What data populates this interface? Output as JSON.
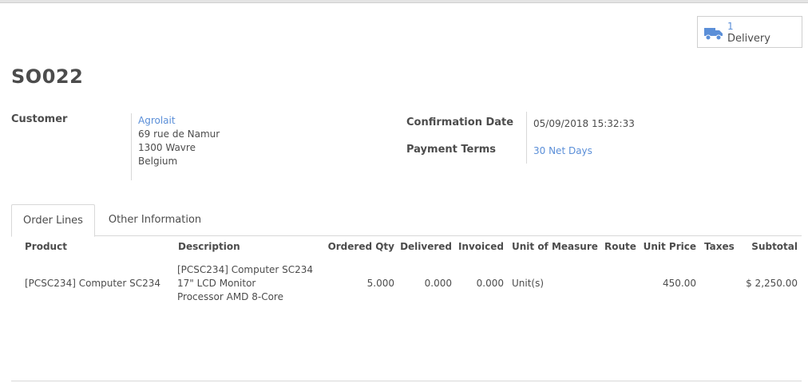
{
  "smart_button": {
    "count": "1",
    "label": "Delivery",
    "icon": "truck-icon"
  },
  "order": {
    "name": "SO022"
  },
  "customer": {
    "label": "Customer",
    "name": "Agrolait",
    "address_line1": "69 rue de Namur",
    "address_line2": "1300 Wavre",
    "address_line3": "Belgium"
  },
  "confirmation": {
    "label": "Confirmation Date",
    "value": "05/09/2018 15:32:33"
  },
  "payment_terms": {
    "label": "Payment Terms",
    "value": "30 Net Days"
  },
  "tabs": [
    {
      "label": "Order Lines",
      "active": true
    },
    {
      "label": "Other Information",
      "active": false
    }
  ],
  "table": {
    "headers": {
      "product": "Product",
      "description": "Description",
      "ordered_qty": "Ordered Qty",
      "delivered": "Delivered",
      "invoiced": "Invoiced",
      "uom": "Unit of Measure",
      "route": "Route",
      "unit_price": "Unit Price",
      "taxes": "Taxes",
      "subtotal": "Subtotal"
    },
    "rows": [
      {
        "product": "[PCSC234] Computer SC234",
        "description_line1": "[PCSC234] Computer SC234",
        "description_line2": "17\" LCD Monitor",
        "description_line3": "Processor AMD 8-Core",
        "ordered_qty": "5.000",
        "delivered": "0.000",
        "invoiced": "0.000",
        "uom": "Unit(s)",
        "route": "",
        "unit_price": "450.00",
        "taxes": "",
        "subtotal": "$ 2,250.00"
      }
    ]
  },
  "colors": {
    "link": "#5b8fd8",
    "text": "#4c4c4c",
    "border": "#d8d8d8"
  }
}
